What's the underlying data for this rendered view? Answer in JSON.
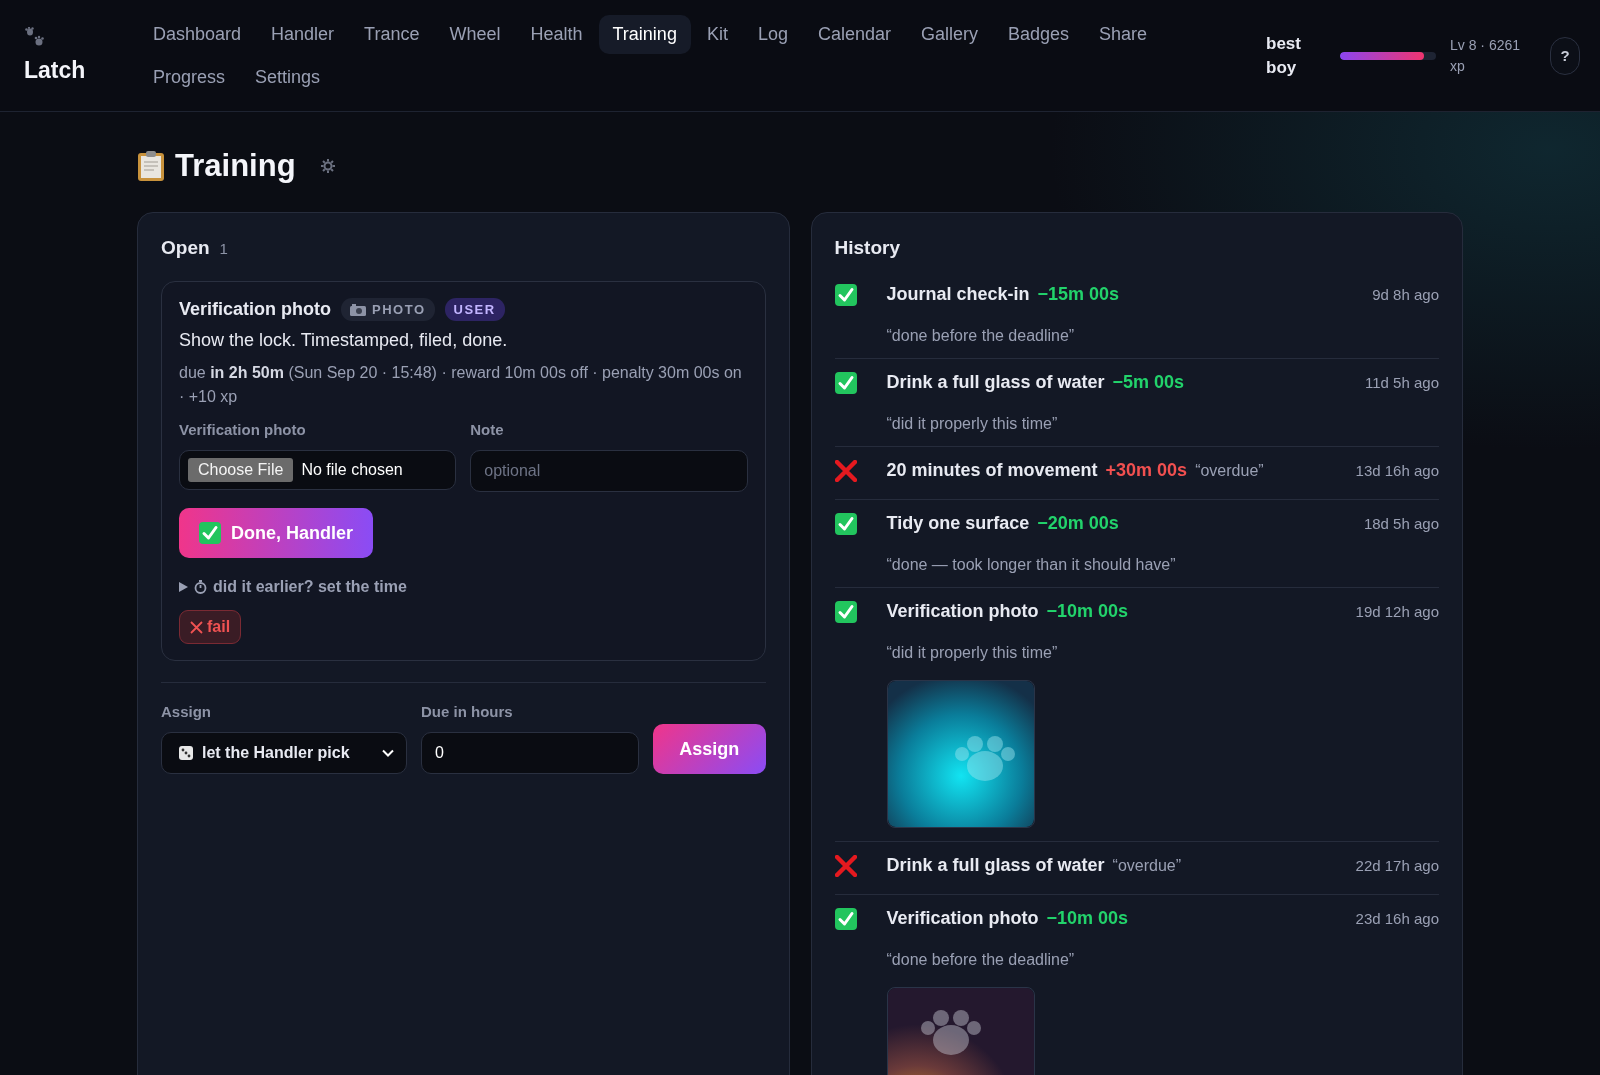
{
  "brand": {
    "name": "Latch"
  },
  "nav": [
    {
      "label": "Dashboard",
      "selected": false
    },
    {
      "label": "Handler",
      "selected": false
    },
    {
      "label": "Trance",
      "selected": false
    },
    {
      "label": "Wheel",
      "selected": false
    },
    {
      "label": "Health",
      "selected": false
    },
    {
      "label": "Training",
      "selected": true
    },
    {
      "label": "Kit",
      "selected": false
    },
    {
      "label": "Log",
      "selected": false
    },
    {
      "label": "Calendar",
      "selected": false
    },
    {
      "label": "Gallery",
      "selected": false
    },
    {
      "label": "Badges",
      "selected": false
    },
    {
      "label": "Share",
      "selected": false
    },
    {
      "label": "Progress",
      "selected": false
    },
    {
      "label": "Settings",
      "selected": false
    }
  ],
  "user": {
    "name": "best boy",
    "level": 0.88,
    "xp_text": "Lv 8 · 6261 xp",
    "help": "?"
  },
  "page_title": "Training",
  "open": {
    "title": "Open",
    "count": "1",
    "task": {
      "title": "Verification photo",
      "badges": [
        {
          "kind": "type",
          "label": "PHOTO"
        },
        {
          "kind": "source",
          "label": "USER"
        }
      ],
      "description": "Show the lock. Timestamped, filed, done.",
      "meta": "due **in 2h 50m** (Sun Sep 20 · 15:48) · reward 10m 00s off · penalty 30m 00s on · +10 xp",
      "file_label": "Verification photo",
      "file_button": "Choose File",
      "file_status": "No file chosen",
      "note_label": "Note",
      "note_placeholder": "optional",
      "done_button": "Done, Handler",
      "earlier_toggle": "did it earlier? set the time",
      "expanded": false,
      "fail_button": "fail"
    },
    "assign": {
      "label": "Assign",
      "value": "let the Handler pick",
      "hours_label": "Due in hours",
      "hours_value": "0",
      "button": "Assign"
    }
  },
  "history": {
    "title": "History",
    "items": [
      {
        "kind": "done",
        "title": "Journal check-in",
        "delta": "−15m 00s",
        "note": "“done before the deadline”",
        "time": "9d 8h ago",
        "photo": false
      },
      {
        "kind": "done",
        "title": "Drink a full glass of water",
        "delta": "−5m 00s",
        "note": "“did it properly this time”",
        "time": "11d 5h ago",
        "photo": false
      },
      {
        "kind": "failed",
        "title": "20 minutes of movement",
        "delta": "+30m 00s",
        "note": "“overdue”",
        "time": "13d 16h ago",
        "photo": false
      },
      {
        "kind": "done",
        "title": "Tidy one surface",
        "delta": "−20m 00s",
        "note": "“done — took longer than it should have”",
        "time": "18d 5h ago",
        "photo": false
      },
      {
        "kind": "done",
        "title": "Verification photo",
        "delta": "−10m 00s",
        "note": "“did it properly this time”",
        "time": "19d 12h ago",
        "photo": true
      },
      {
        "kind": "failed",
        "title": "Drink a full glass of water",
        "note": "“overdue”",
        "time": "22d 17h ago",
        "photo": false
      },
      {
        "kind": "done",
        "title": "Verification photo",
        "delta": "−10m 00s",
        "note": "“done before the deadline”",
        "time": "23d 16h ago",
        "photo": true
      }
    ]
  }
}
